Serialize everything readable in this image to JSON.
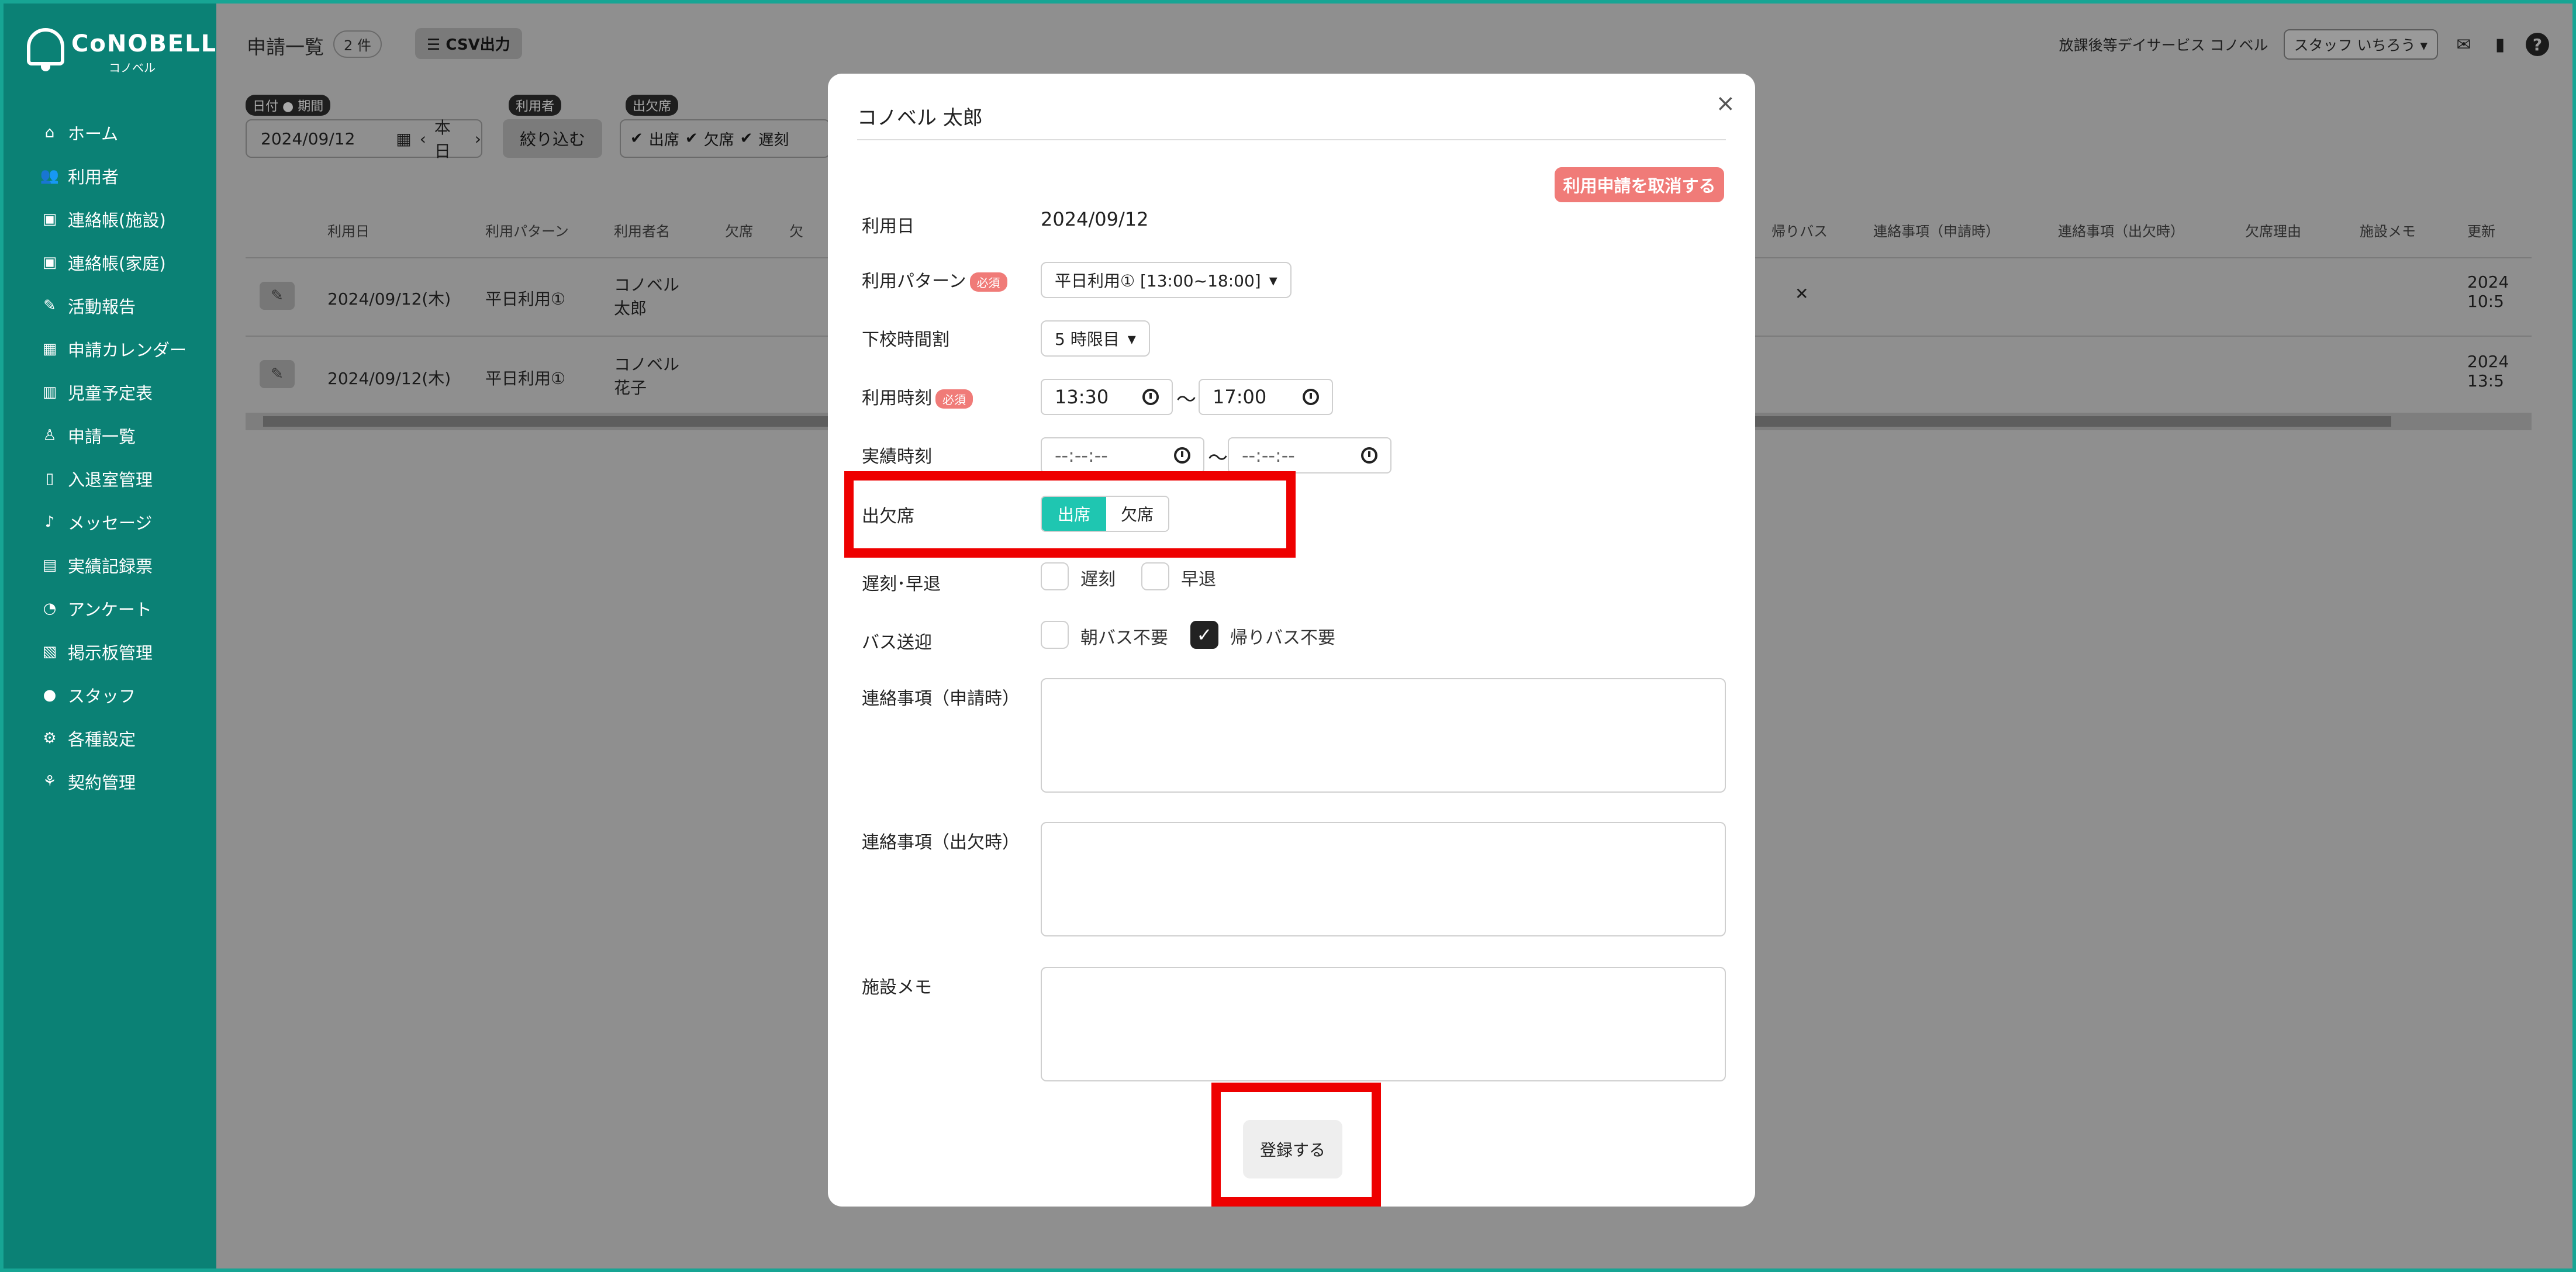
{
  "brand": {
    "name": "CoNOBELL",
    "sub": "コノベル"
  },
  "sidebar": {
    "items": [
      {
        "label": "ホーム",
        "icon": "home-icon",
        "glyph": "⌂"
      },
      {
        "label": "利用者",
        "icon": "users-icon",
        "glyph": "👥"
      },
      {
        "label": "連絡帳(施設)",
        "icon": "notebook-icon",
        "glyph": "▣"
      },
      {
        "label": "連絡帳(家庭)",
        "icon": "notebook-icon",
        "glyph": "▣"
      },
      {
        "label": "活動報告",
        "icon": "edit-icon",
        "glyph": "✎"
      },
      {
        "label": "申請カレンダー",
        "icon": "calendar-icon",
        "glyph": "▦"
      },
      {
        "label": "児童予定表",
        "icon": "building-icon",
        "glyph": "▥"
      },
      {
        "label": "申請一覧",
        "icon": "child-icon",
        "glyph": "♙"
      },
      {
        "label": "入退室管理",
        "icon": "tablet-icon",
        "glyph": "▯"
      },
      {
        "label": "メッセージ",
        "icon": "bell-icon",
        "glyph": "♪"
      },
      {
        "label": "実績記録票",
        "icon": "table-icon",
        "glyph": "▤"
      },
      {
        "label": "アンケート",
        "icon": "chart-pie-icon",
        "glyph": "◔"
      },
      {
        "label": "掲示板管理",
        "icon": "file-icon",
        "glyph": "▧"
      },
      {
        "label": "スタッフ",
        "icon": "person-icon",
        "glyph": "●"
      },
      {
        "label": "各種設定",
        "icon": "gear-icon",
        "glyph": "⚙"
      },
      {
        "label": "契約管理",
        "icon": "handshake-icon",
        "glyph": "⚘"
      }
    ]
  },
  "header": {
    "title": "申請一覧",
    "count": "2 件",
    "csv_label": "CSV出力",
    "facility": "放課後等デイサービス コノベル",
    "staff": "スタッフ いちろう"
  },
  "filters": {
    "date_chip": "日付",
    "period_chip": "期間",
    "date_value": "2024/09/12",
    "today": "本日",
    "user_chip": "利用者",
    "narrow": "絞り込む",
    "attendance_chip": "出欠席",
    "options": [
      "出席",
      "欠席",
      "遅刻"
    ]
  },
  "table": {
    "headers": [
      "利用日",
      "利用パターン",
      "利用者名",
      "欠席",
      "欠",
      "帰りバス",
      "連絡事項（申請時）",
      "連絡事項（出欠時）",
      "欠席理由",
      "施設メモ",
      "更新"
    ],
    "rows": [
      {
        "date": "2024/09/12(木)",
        "pattern": "平日利用①",
        "name": "コノベル 太郎",
        "bus": "✕",
        "updated": "2024 10:5"
      },
      {
        "date": "2024/09/12(木)",
        "pattern": "平日利用①",
        "name": "コノベル 花子",
        "bus": "",
        "updated": "2024 13:5"
      }
    ]
  },
  "modal": {
    "title": "コノベル 太郎",
    "cancel_label": "利用申請を取消する",
    "required": "必須",
    "fields": {
      "date_label": "利用日",
      "date_value": "2024/09/12",
      "pattern_label": "利用パターン",
      "pattern_value": "平日利用① [13:00~18:00]",
      "period_label": "下校時間割",
      "period_value": "5 時限目",
      "time_label": "利用時刻",
      "time_from": "13:30",
      "time_to": "17:00",
      "actual_label": "実績時刻",
      "actual_from": "--:--:--",
      "actual_to": "--:--:--",
      "tilde": "〜",
      "attendance_label": "出欠席",
      "attend_on": "出席",
      "attend_off": "欠席",
      "late_label": "遅刻･早退",
      "late": "遅刻",
      "early": "早退",
      "bus_label": "バス送迎",
      "morning_bus": "朝バス不要",
      "return_bus": "帰りバス不要",
      "note_apply_label": "連絡事項（申請時）",
      "note_attend_label": "連絡事項（出欠時）",
      "memo_label": "施設メモ"
    },
    "register_label": "登録する"
  },
  "colors": {
    "accent": "#1fc6b1",
    "sidebar": "#0b8175",
    "danger": "#f07b78",
    "highlight": "#ee0000"
  }
}
